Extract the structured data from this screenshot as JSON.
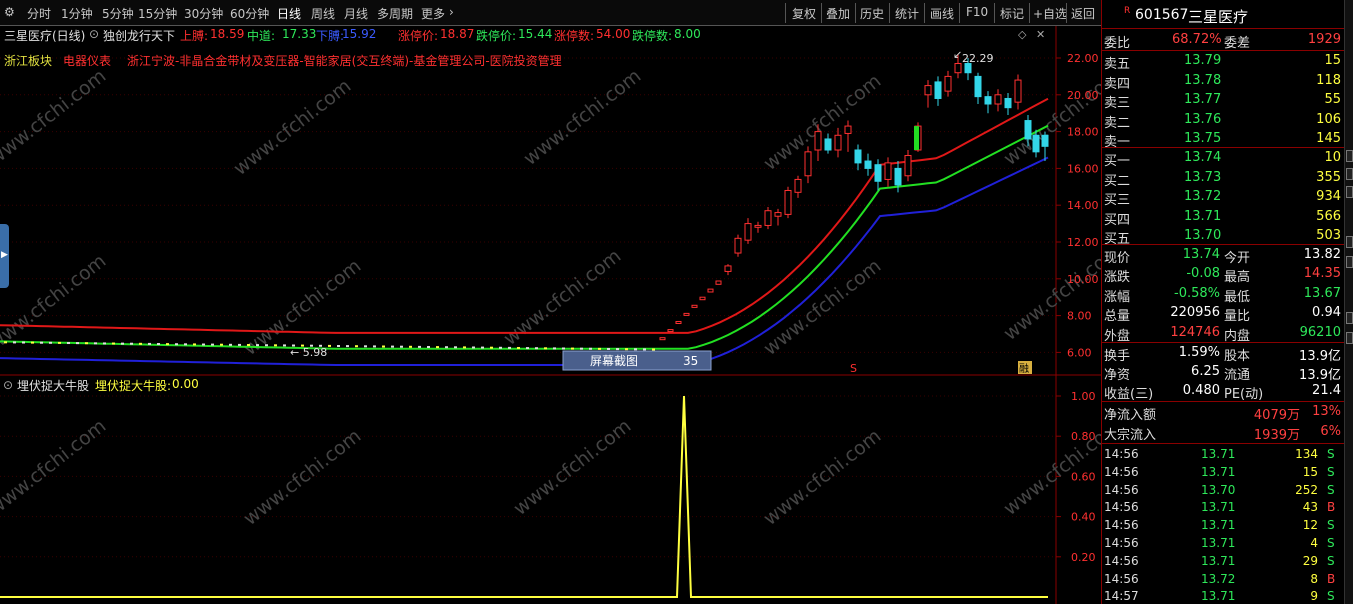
{
  "toolbar": {
    "periods": [
      "分时",
      "1分钟",
      "5分钟",
      "15分钟",
      "30分钟",
      "60分钟",
      "日线",
      "周线",
      "月线",
      "多周期",
      "更多"
    ],
    "active": "日线",
    "right_buttons": [
      "复权",
      "叠加",
      "历史",
      "统计",
      "画线",
      "F10",
      "标记",
      "+自选",
      "返回"
    ]
  },
  "title": {
    "stock": "三星医疗(日线)",
    "indicator": "独创龙行天下",
    "upper_label": "上膊:",
    "upper_value": "18.59",
    "mid_label": "中道:",
    "mid_value": "17.33",
    "lower_label": "下膊:",
    "lower_value": "15.92",
    "limit_up_label": "涨停价:",
    "limit_up_value": "18.87",
    "limit_down_label": "跌停价:",
    "limit_down_value": "15.44",
    "limit_up_count_label": "涨停数:",
    "limit_up_count_value": "54.00",
    "limit_down_count_label": "跌停数:",
    "limit_down_count_value": "8.00"
  },
  "sectors": {
    "s1": "浙江板块",
    "s2": "电器仪表",
    "s3": "浙江宁波-非晶合金带材及变压器-智能家居(交互终端)-基金管理公司-医院投资管理"
  },
  "main_axis": [
    "22.00",
    "20.00",
    "18.00",
    "16.00",
    "14.00",
    "12.00",
    "10.00",
    "8.00",
    "6.00"
  ],
  "annotations": {
    "high": "22.29",
    "low": "5.98",
    "marker_s": "S",
    "marker_r": "融"
  },
  "screenshot_tag": {
    "label": "屏幕截图",
    "value": "35"
  },
  "indicator_panel": {
    "name": "埋伏捉大牛股",
    "value_label": "埋伏捉大牛股:",
    "value": "0.00",
    "axis": [
      "1.00",
      "0.80",
      "0.60",
      "0.40",
      "0.20"
    ]
  },
  "watermark": "www.cfchi.com",
  "quote": {
    "badge": "R",
    "code": "601567",
    "name": "三星医疗",
    "weibi_label": "委比",
    "weibi": "68.72%",
    "weicha_label": "委差",
    "weicha": "1929",
    "sells": [
      {
        "label": "卖五",
        "price": "13.79",
        "vol": "15"
      },
      {
        "label": "卖四",
        "price": "13.78",
        "vol": "118"
      },
      {
        "label": "卖三",
        "price": "13.77",
        "vol": "55"
      },
      {
        "label": "卖二",
        "price": "13.76",
        "vol": "106"
      },
      {
        "label": "卖一",
        "price": "13.75",
        "vol": "145"
      }
    ],
    "buys": [
      {
        "label": "买一",
        "price": "13.74",
        "vol": "10"
      },
      {
        "label": "买二",
        "price": "13.73",
        "vol": "355"
      },
      {
        "label": "买三",
        "price": "13.72",
        "vol": "934"
      },
      {
        "label": "买四",
        "price": "13.71",
        "vol": "566"
      },
      {
        "label": "买五",
        "price": "13.70",
        "vol": "503"
      }
    ],
    "stats": [
      {
        "l1": "现价",
        "v1": "13.74",
        "c1": "#2ee85a",
        "l2": "今开",
        "v2": "13.82",
        "c2": "#ffffff"
      },
      {
        "l1": "涨跌",
        "v1": "-0.08",
        "c1": "#2ee85a",
        "l2": "最高",
        "v2": "14.35",
        "c2": "#ff4040"
      },
      {
        "l1": "涨幅",
        "v1": "-0.58%",
        "c1": "#2ee85a",
        "l2": "最低",
        "v2": "13.67",
        "c2": "#2ee85a"
      },
      {
        "l1": "总量",
        "v1": "220956",
        "c1": "#ffffff",
        "l2": "量比",
        "v2": "0.94",
        "c2": "#ffffff"
      },
      {
        "l1": "外盘",
        "v1": "124746",
        "c1": "#ff4040",
        "l2": "内盘",
        "v2": "96210",
        "c2": "#2ee85a"
      }
    ],
    "stats2": [
      {
        "l1": "换手",
        "v1": "1.59%",
        "l2": "股本",
        "v2": "13.9亿"
      },
      {
        "l1": "净资",
        "v1": "6.25",
        "l2": "流通",
        "v2": "13.9亿"
      },
      {
        "l1": "收益(三)",
        "v1": "0.480",
        "l2": "PE(动)",
        "v2": "21.4"
      }
    ],
    "flow": [
      {
        "label": "净流入额",
        "value": "4079万",
        "pct": "13%"
      },
      {
        "label": "大宗流入",
        "value": "1939万",
        "pct": "6%"
      }
    ],
    "ticks": [
      {
        "time": "14:56",
        "price": "13.71",
        "vol": "134",
        "side": "S"
      },
      {
        "time": "14:56",
        "price": "13.71",
        "vol": "15",
        "side": "S"
      },
      {
        "time": "14:56",
        "price": "13.70",
        "vol": "252",
        "side": "S"
      },
      {
        "time": "14:56",
        "price": "13.71",
        "vol": "43",
        "side": "B"
      },
      {
        "time": "14:56",
        "price": "13.71",
        "vol": "12",
        "side": "S"
      },
      {
        "time": "14:56",
        "price": "13.71",
        "vol": "4",
        "side": "S"
      },
      {
        "time": "14:56",
        "price": "13.71",
        "vol": "29",
        "side": "S"
      },
      {
        "time": "14:56",
        "price": "13.72",
        "vol": "8",
        "side": "B"
      },
      {
        "time": "14:57",
        "price": "13.71",
        "vol": "9",
        "side": "S"
      }
    ]
  },
  "colors": {
    "up": "#ff3030",
    "down": "#33d6e8",
    "green": "#2ee85a",
    "band_upper": "#e01818",
    "band_mid": "#22e022",
    "band_lower": "#2020d8",
    "indicator": "#ffff40"
  }
}
